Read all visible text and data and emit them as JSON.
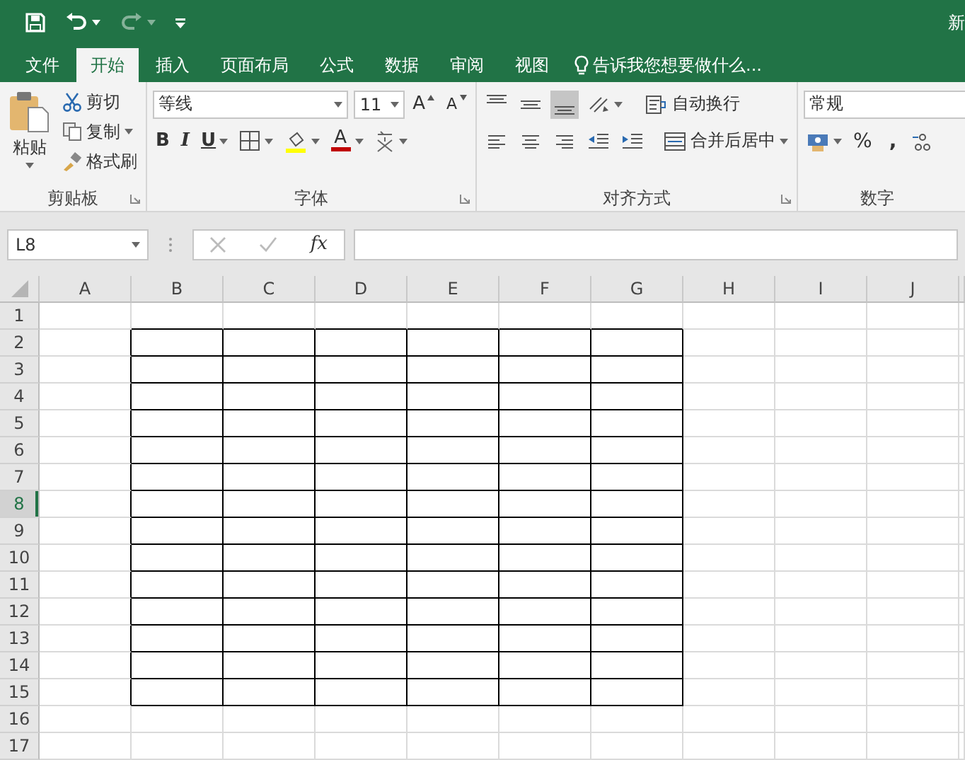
{
  "window": {
    "title": "新"
  },
  "quick_access": {
    "redo_disabled": true
  },
  "tabs": [
    {
      "label": "文件",
      "selected": false
    },
    {
      "label": "开始",
      "selected": true
    },
    {
      "label": "插入",
      "selected": false
    },
    {
      "label": "页面布局",
      "selected": false
    },
    {
      "label": "公式",
      "selected": false
    },
    {
      "label": "数据",
      "selected": false
    },
    {
      "label": "审阅",
      "selected": false
    },
    {
      "label": "视图",
      "selected": false
    }
  ],
  "tell_me": {
    "placeholder": "告诉我您想要做什么..."
  },
  "clipboard": {
    "label": "剪贴板",
    "paste": "粘贴",
    "cut": "剪切",
    "copy": "复制",
    "format_painter": "格式刷"
  },
  "font": {
    "label": "字体",
    "font_name": "等线",
    "font_size": "11",
    "grow": "A",
    "shrink": "A",
    "styles": [
      {
        "kind": "bold",
        "label": "B"
      },
      {
        "kind": "italic",
        "label": "I"
      },
      {
        "kind": "underline",
        "label": "U"
      }
    ],
    "fill_color": {
      "color": "#ffff00"
    },
    "font_color": {
      "label": "A",
      "color": "#c00000"
    }
  },
  "alignment": {
    "label": "对齐方式",
    "wrap": "自动换行",
    "merge": "合并后居中",
    "vertical": [
      {
        "kind": "top",
        "selected": false
      },
      {
        "kind": "middle",
        "selected": false
      },
      {
        "kind": "bottom",
        "selected": true
      }
    ]
  },
  "number": {
    "label": "数字",
    "format": "常规",
    "percent": "%",
    "comma": ","
  },
  "formula_bar": {
    "name_box": "L8",
    "fx": "fx"
  },
  "sheet": {
    "columns": [
      {
        "label": "A",
        "bordered": false
      },
      {
        "label": "B",
        "bordered": true
      },
      {
        "label": "C",
        "bordered": true
      },
      {
        "label": "D",
        "bordered": true
      },
      {
        "label": "E",
        "bordered": true
      },
      {
        "label": "F",
        "bordered": true
      },
      {
        "label": "G",
        "bordered": true
      },
      {
        "label": "H",
        "bordered": false
      },
      {
        "label": "I",
        "bordered": false
      },
      {
        "label": "J",
        "bordered": false
      }
    ],
    "rows": [
      {
        "label": "1",
        "selected": false,
        "bordered": false
      },
      {
        "label": "2",
        "selected": false,
        "bordered": true
      },
      {
        "label": "3",
        "selected": false,
        "bordered": true
      },
      {
        "label": "4",
        "selected": false,
        "bordered": true
      },
      {
        "label": "5",
        "selected": false,
        "bordered": true
      },
      {
        "label": "6",
        "selected": false,
        "bordered": true
      },
      {
        "label": "7",
        "selected": false,
        "bordered": true
      },
      {
        "label": "8",
        "selected": true,
        "bordered": true
      },
      {
        "label": "9",
        "selected": false,
        "bordered": true
      },
      {
        "label": "10",
        "selected": false,
        "bordered": true
      },
      {
        "label": "11",
        "selected": false,
        "bordered": true
      },
      {
        "label": "12",
        "selected": false,
        "bordered": true
      },
      {
        "label": "13",
        "selected": false,
        "bordered": true
      },
      {
        "label": "14",
        "selected": false,
        "bordered": true
      },
      {
        "label": "15",
        "selected": false,
        "bordered": true
      },
      {
        "label": "16",
        "selected": false,
        "bordered": false
      },
      {
        "label": "17",
        "selected": false,
        "bordered": false
      }
    ]
  }
}
